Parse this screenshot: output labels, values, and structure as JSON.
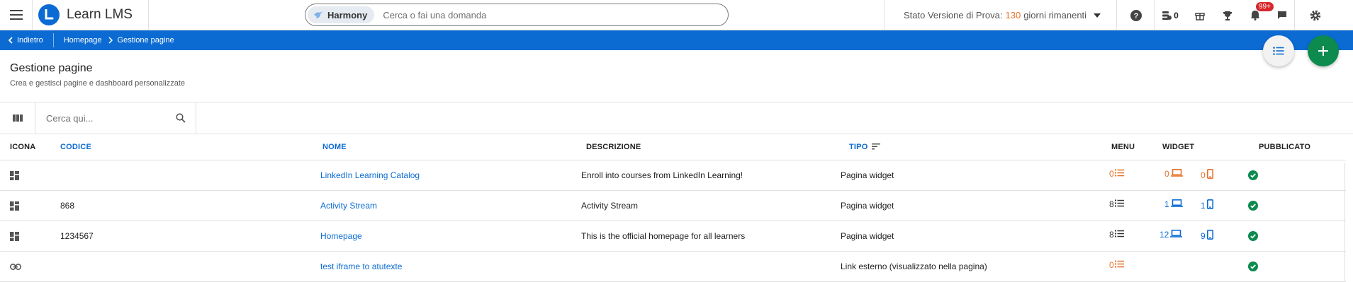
{
  "app": {
    "name": "Learn LMS"
  },
  "search": {
    "chip": "Harmony",
    "placeholder": "Cerca o fai una domanda"
  },
  "trial": {
    "prefix": "Stato Versione di Prova:",
    "days": "130",
    "suffix": "giorni rimanenti"
  },
  "header": {
    "credits": "0",
    "notifications_badge": "99+"
  },
  "breadcrumb": {
    "back": "Indietro",
    "home": "Homepage",
    "current": "Gestione pagine"
  },
  "page": {
    "title": "Gestione pagine",
    "subtitle": "Crea e gestisci pagine e dashboard personalizzate"
  },
  "filter": {
    "placeholder": "Cerca qui..."
  },
  "table": {
    "headers": {
      "icon": "ICONA",
      "code": "CODICE",
      "name": "NOME",
      "description": "DESCRIZIONE",
      "type": "TIPO",
      "menu": "MENU",
      "widget": "WIDGET",
      "published": "PUBBLICATO"
    },
    "rows": [
      {
        "icon": "dashboard-icon",
        "code": "",
        "name": "LinkedIn Learning Catalog",
        "description": "Enroll into courses from LinkedIn Learning!",
        "type": "Pagina widget",
        "menu": "0",
        "menu_color": "#e8722b",
        "widget_desktop": "0",
        "widget_mobile": "0",
        "widget_color": "#e8722b",
        "published": true
      },
      {
        "icon": "dashboard-icon",
        "code": "868",
        "name": "Activity Stream",
        "description": "Activity Stream",
        "type": "Pagina widget",
        "menu": "8",
        "menu_color": "#333333",
        "widget_desktop": "1",
        "widget_mobile": "1",
        "widget_color": "#0b6bd3",
        "published": true
      },
      {
        "icon": "dashboard-icon",
        "code": "1234567",
        "name": "Homepage",
        "description": "This is the official homepage for all learners",
        "type": "Pagina widget",
        "menu": "8",
        "menu_color": "#333333",
        "widget_desktop": "12",
        "widget_mobile": "9",
        "widget_color": "#0b6bd3",
        "published": true
      },
      {
        "icon": "link-icon",
        "code": "",
        "name": "test iframe to atutexte",
        "description": "",
        "type": "Link esterno (visualizzato nella pagina)",
        "menu": "0",
        "menu_color": "#e8722b",
        "widget_desktop": "",
        "widget_mobile": "",
        "widget_color": "",
        "published": true
      }
    ]
  },
  "colors": {
    "primary": "#0b6bd3",
    "accent": "#e8722b",
    "success": "#0d8a4e",
    "badge": "#d8262c"
  }
}
